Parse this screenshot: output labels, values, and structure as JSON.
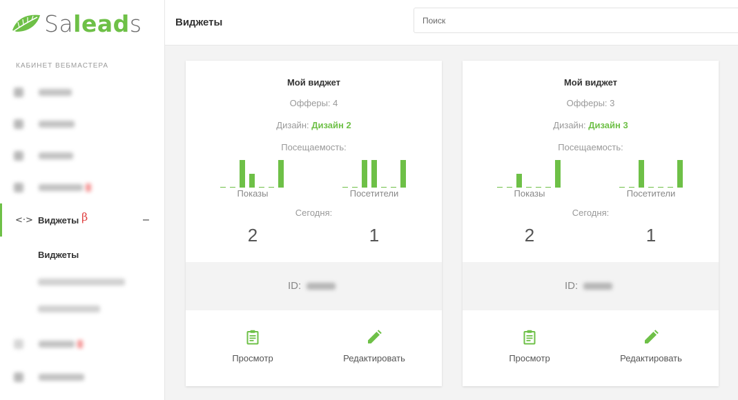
{
  "brand": {
    "text_a": "Sa",
    "text_b": "lead",
    "text_c": "s"
  },
  "sidebar": {
    "section_title": "Кабинет вебмастера",
    "active_item": {
      "icon": "<·>",
      "label": "Виджеты",
      "badge": "β",
      "toggle": "–"
    },
    "sub_active": "Виджеты"
  },
  "header": {
    "title": "Виджеты",
    "search_placeholder": "Поиск"
  },
  "colors": {
    "accent": "#6ec047",
    "beta": "#e04040"
  },
  "widgets": [
    {
      "title": "Мой виджет",
      "offers_label": "Офферы: 4",
      "design_label": "Дизайн:",
      "design_value": "Дизайн 2",
      "visits_label": "Посещаемость:",
      "shows_label": "Показы",
      "visitors_label": "Посетители",
      "today_label": "Сегодня:",
      "shows_today": "2",
      "visitors_today": "1",
      "id_label": "ID:",
      "view_label": "Просмотр",
      "edit_label": "Редактировать",
      "shows_series": [
        0,
        0,
        2,
        1,
        0,
        0,
        2
      ],
      "visitors_series": [
        0,
        0,
        2,
        2,
        0,
        0,
        2
      ]
    },
    {
      "title": "Мой виджет",
      "offers_label": "Офферы: 3",
      "design_label": "Дизайн:",
      "design_value": "Дизайн 3",
      "visits_label": "Посещаемость:",
      "shows_label": "Показы",
      "visitors_label": "Посетители",
      "today_label": "Сегодня:",
      "shows_today": "2",
      "visitors_today": "1",
      "id_label": "ID:",
      "view_label": "Просмотр",
      "edit_label": "Редактировать",
      "shows_series": [
        0,
        0,
        1,
        0,
        0,
        0,
        2
      ],
      "visitors_series": [
        0,
        0,
        2,
        0,
        0,
        0,
        2
      ]
    }
  ]
}
